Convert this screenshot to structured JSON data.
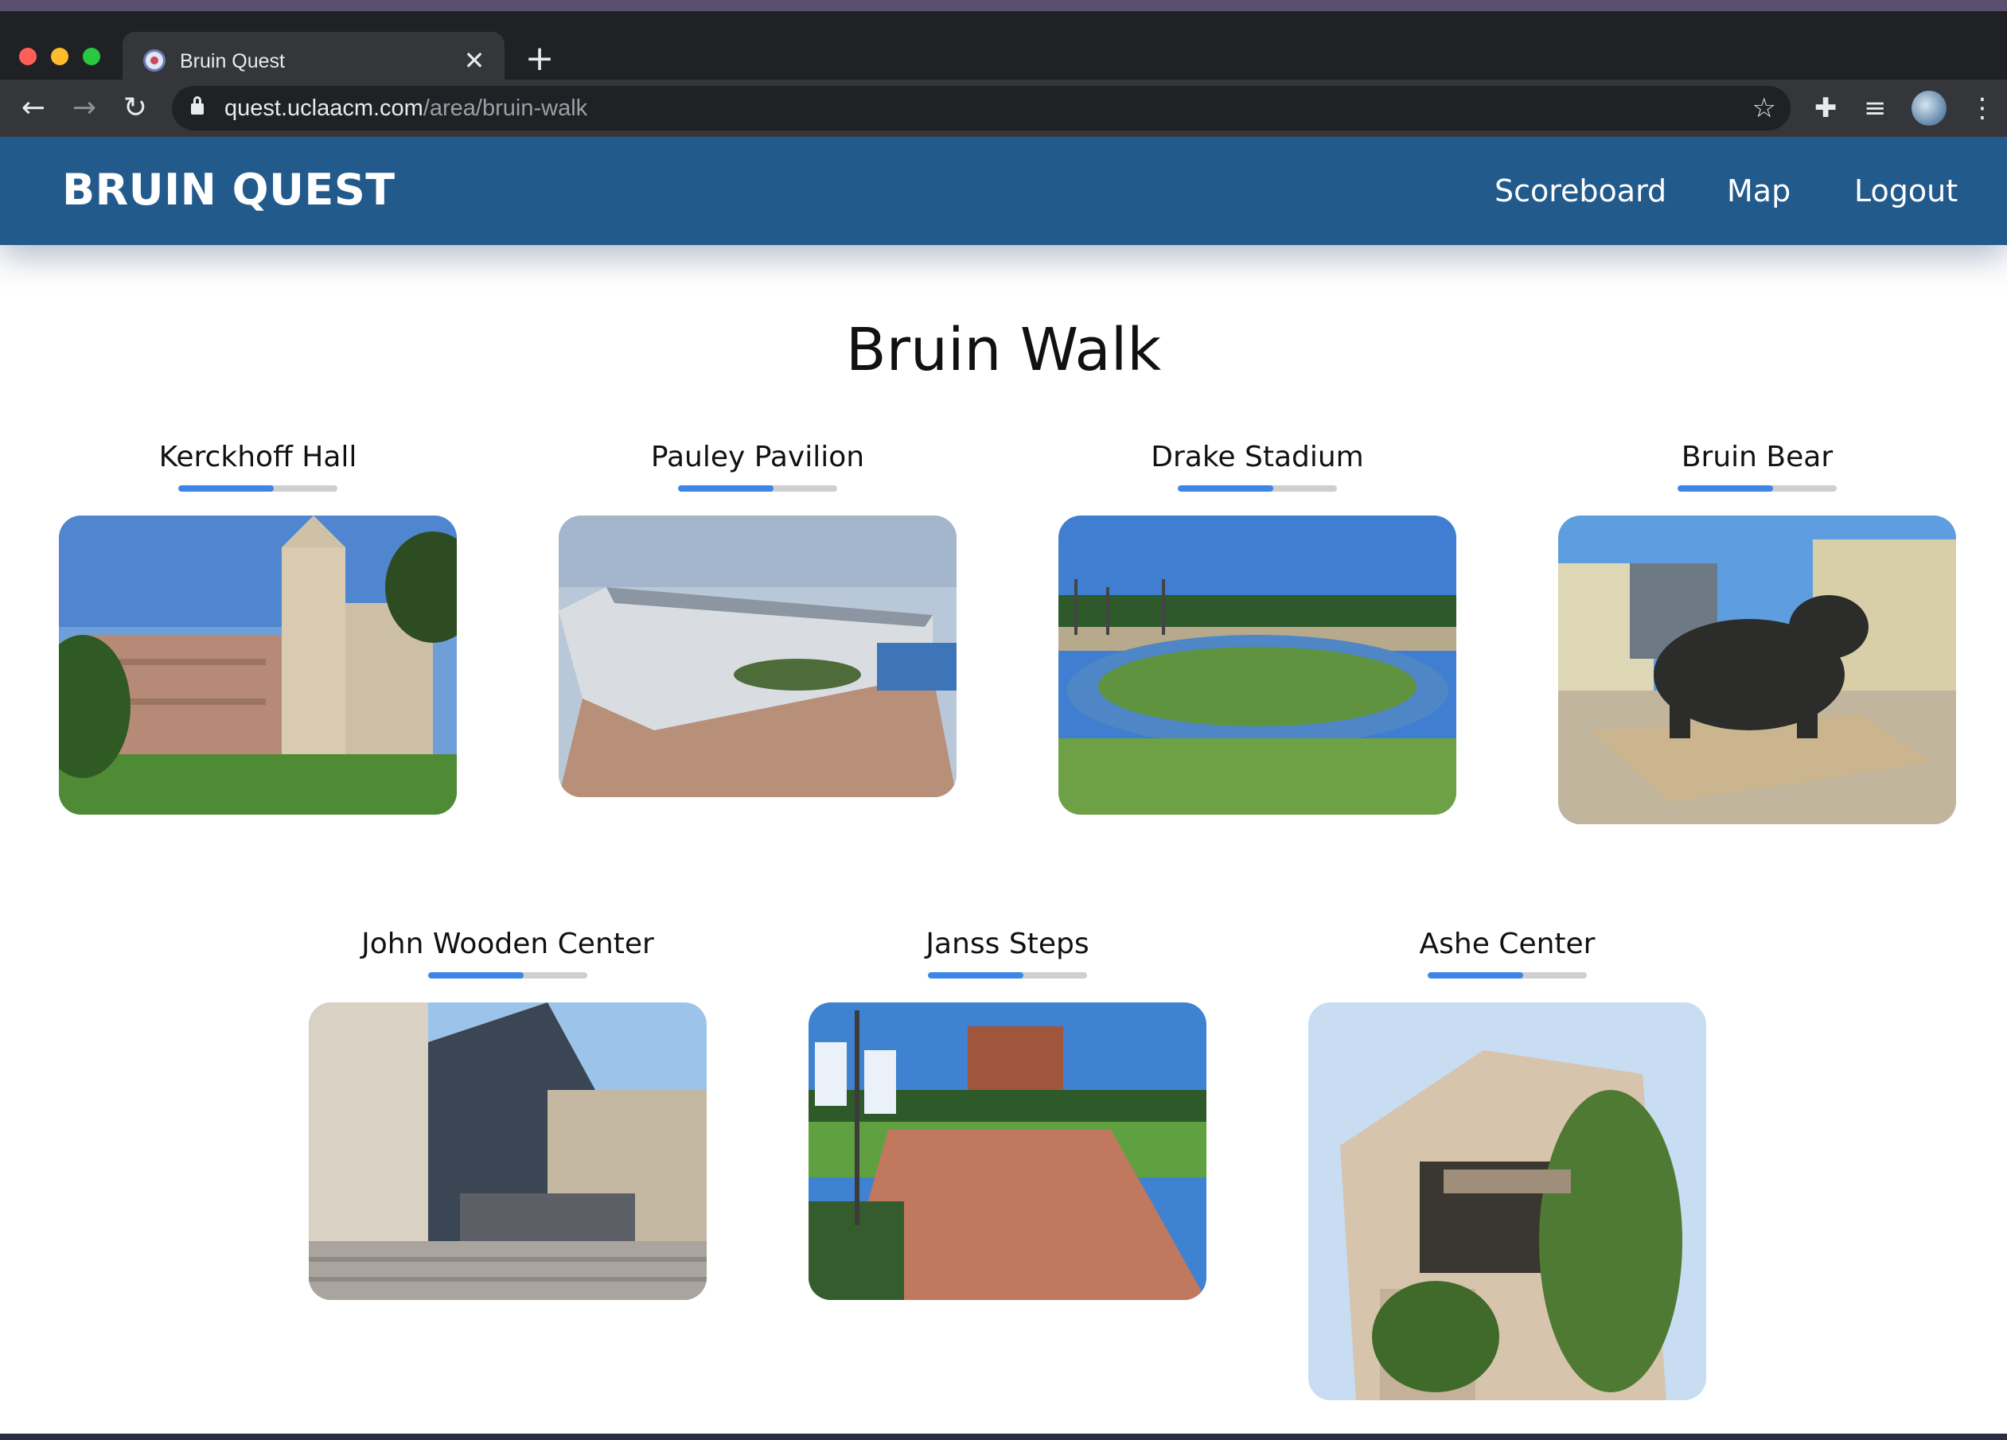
{
  "browser": {
    "tab_title": "Bruin Quest",
    "url_host": "quest.uclaacm.com",
    "url_path": "/area/bruin-walk",
    "icons": [
      "close-icon",
      "plus-icon",
      "back-arrow-icon",
      "forward-arrow-icon",
      "reload-icon",
      "lock-icon",
      "star-icon",
      "puzzle-icon",
      "media-icon",
      "avatar",
      "kebab-menu-icon"
    ]
  },
  "navbar": {
    "brand": "BRUIN QUEST",
    "links": {
      "scoreboard": "Scoreboard",
      "map": "Map",
      "logout": "Logout"
    },
    "color": "#225a8c"
  },
  "area": {
    "title": "Bruin Walk",
    "locations": [
      {
        "name": "Kerckhoff Hall",
        "progress": 0.6
      },
      {
        "name": "Pauley Pavilion",
        "progress": 0.6
      },
      {
        "name": "Drake Stadium",
        "progress": 0.6
      },
      {
        "name": "Bruin Bear",
        "progress": 0.6
      },
      {
        "name": "John Wooden Center",
        "progress": 0.6
      },
      {
        "name": "Janss Steps",
        "progress": 0.6
      },
      {
        "name": "Ashe Center",
        "progress": 0.6
      }
    ],
    "progress_color": "#3d86e8",
    "progress_track_color": "#cfcfcf"
  }
}
